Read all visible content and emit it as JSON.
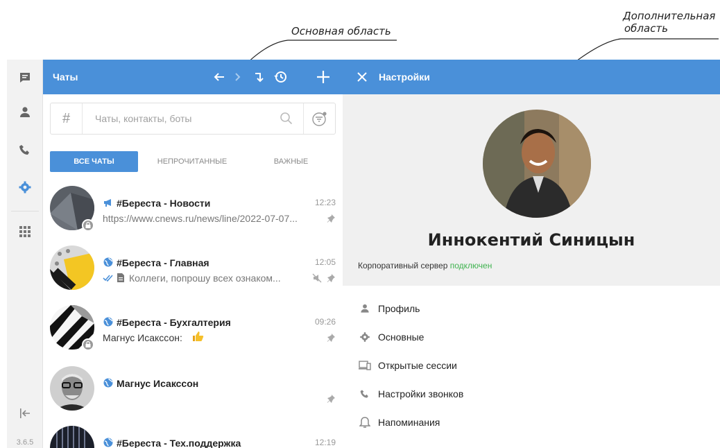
{
  "annotations": {
    "main_area": "Основная область",
    "extra_area_line1": "Дополнительная",
    "extra_area_line2": "область"
  },
  "rail": {
    "items": [
      {
        "id": "chats",
        "icon": "chat-bubble-icon"
      },
      {
        "id": "contacts",
        "icon": "person-icon"
      },
      {
        "id": "calls",
        "icon": "phone-icon"
      },
      {
        "id": "settings",
        "icon": "gear-icon",
        "active": true
      },
      {
        "id": "apps",
        "icon": "grid-icon"
      }
    ],
    "collapse_icon": "collapse-left-icon",
    "version": "3.6.5"
  },
  "chats_header": {
    "title": "Чаты",
    "icons": [
      "arrow-left-icon",
      "arrow-right-icon",
      "forward-icon",
      "history-icon",
      "plus-icon"
    ]
  },
  "settings_header": {
    "title": "Настройки",
    "close_icon": "close-icon"
  },
  "search": {
    "hash": "#",
    "placeholder": "Чаты, контакты, боты"
  },
  "tabs": [
    {
      "label": "ВСЕ ЧАТЫ",
      "active": true
    },
    {
      "label": "НЕПРОЧИТАННЫЕ",
      "active": false
    },
    {
      "label": "ВАЖНЫЕ",
      "active": false
    }
  ],
  "chats": [
    {
      "name": "#Береста - Новости",
      "time": "12:23",
      "preview": "https://www.cnews.ru/news/line/2022-07-07...",
      "type_icon": "megaphone-icon"
    },
    {
      "name": "#Береста - Главная",
      "time": "12:05",
      "preview": "Коллеги, попрошу всех ознаком...",
      "type_icon": "globe-icon"
    },
    {
      "name": "#Береста - Бухгалтерия",
      "time": "09:26",
      "preview": "Магнус Исакссон:",
      "type_icon": "globe-icon"
    },
    {
      "name": "Магнус Исакссон",
      "time": "",
      "preview": "",
      "type_icon": "globe-icon"
    },
    {
      "name": "#Береста - Тех.поддержка",
      "time": "12:19",
      "preview": "",
      "type_icon": "globe-icon"
    }
  ],
  "profile": {
    "name": "Иннокентий Синицын",
    "server_label": "Корпоративный сервер",
    "server_status": "подключен",
    "status_color": "#3fb34f"
  },
  "menu": [
    {
      "label": "Профиль",
      "icon": "person-icon"
    },
    {
      "label": "Основные",
      "icon": "gear-icon"
    },
    {
      "label": "Открытые сессии",
      "icon": "devices-icon"
    },
    {
      "label": "Настройки звонков",
      "icon": "phone-icon"
    },
    {
      "label": "Напоминания",
      "icon": "bell-icon"
    }
  ],
  "colors": {
    "accent": "#4a90d9",
    "rail_bg": "#f2f2f2",
    "profile_bg": "#f0f0f0"
  }
}
